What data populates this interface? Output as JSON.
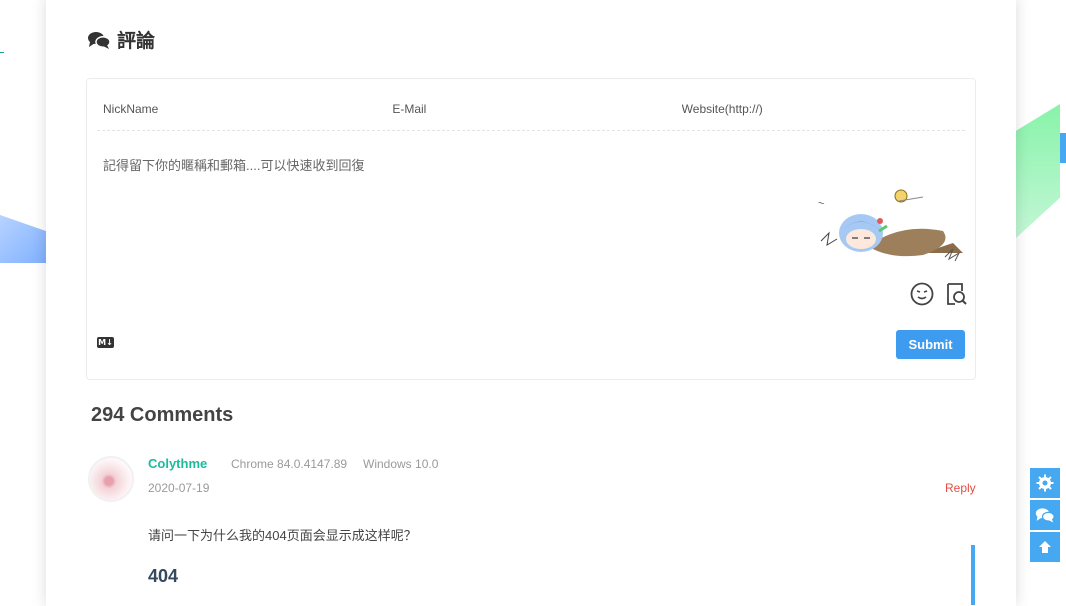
{
  "comments_section": {
    "title": "評論",
    "form": {
      "nickname_placeholder": "NickName",
      "email_placeholder": "E-Mail",
      "website_placeholder": "Website(http://)",
      "textarea_placeholder": "記得留下你的暱稱和郵箱....可以快速收到回復",
      "markdown_badge": "M↓",
      "submit_label": "Submit"
    },
    "count_label": "294 Comments",
    "items": [
      {
        "author": "Colythme",
        "browser": "Chrome 84.0.4147.89",
        "os": "Windows 10.0",
        "date": "2020-07-19",
        "reply_label": "Reply",
        "text": "请问一下为什么我的404页面会显示成这样呢？",
        "quote_heading": "404"
      }
    ]
  },
  "colors": {
    "accent": "#45a8f0",
    "submit": "#3d9cf0",
    "author": "#1abc9c",
    "reply": "#e54d42"
  },
  "floating_buttons": [
    "gear-icon",
    "comments-icon",
    "arrow-up-icon"
  ]
}
